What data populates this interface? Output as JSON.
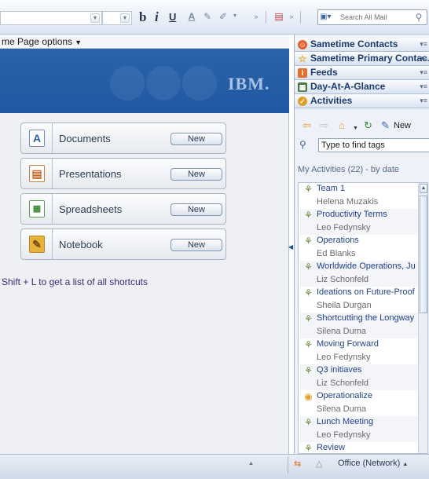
{
  "toolbar": {
    "bold": "b",
    "italic": "i",
    "underline": "U",
    "search_placeholder": "Search All Mail"
  },
  "home": {
    "options_label": "me Page options",
    "logo": "IBM.",
    "apps": [
      {
        "label": "Documents",
        "new_label": "New",
        "icon": "documents-icon"
      },
      {
        "label": "Presentations",
        "new_label": "New",
        "icon": "presentations-icon"
      },
      {
        "label": "Spreadsheets",
        "new_label": "New",
        "icon": "spreadsheets-icon"
      },
      {
        "label": "Notebook",
        "new_label": "New",
        "icon": "notebook-icon"
      }
    ],
    "shortcut_hint": "Shift + L to get a list of all shortcuts"
  },
  "sidebar": {
    "panels": [
      {
        "title": "Sametime Contacts",
        "icon": "sametime-icon",
        "color": "#e4622a"
      },
      {
        "title": "Sametime Primary Contac...",
        "icon": "star-icon",
        "color": "#e8a92a"
      },
      {
        "title": "Feeds",
        "icon": "feeds-icon",
        "color": "#e2702a"
      },
      {
        "title": "Day-At-A-Glance",
        "icon": "calendar-icon",
        "color": "#4b7a3e"
      },
      {
        "title": "Activities",
        "icon": "activities-icon",
        "color": "#e0a020"
      }
    ],
    "activities": {
      "new_label": "New",
      "tag_search_placeholder": "Type to find tags",
      "list_header": "My Activities (22) - by date",
      "items": [
        {
          "title": "Team 1",
          "owner": "Helena Muzakis"
        },
        {
          "title": "Productivity Terms",
          "owner": "Leo Fedynsky"
        },
        {
          "title": "Operations",
          "owner": "Ed Blanks"
        },
        {
          "title": "Worldwide Operations, Ju",
          "owner": "Liz Schonfeld"
        },
        {
          "title": "Ideations on Future-Proof",
          "owner": "Sheila Durgan"
        },
        {
          "title": "Shortcutting the Longway",
          "owner": "Silena Duma"
        },
        {
          "title": "Moving Forward",
          "owner": "Leo Fedynsky"
        },
        {
          "title": "Q3 initiaves",
          "owner": "Liz Schonfeld"
        },
        {
          "title": "Operationalize",
          "owner": "Silena Duma"
        },
        {
          "title": "Lunch Meeting",
          "owner": "Leo Fedynsky"
        },
        {
          "title": "Review",
          "owner": ""
        }
      ]
    }
  },
  "statusbar": {
    "network": "Office (Network)"
  }
}
